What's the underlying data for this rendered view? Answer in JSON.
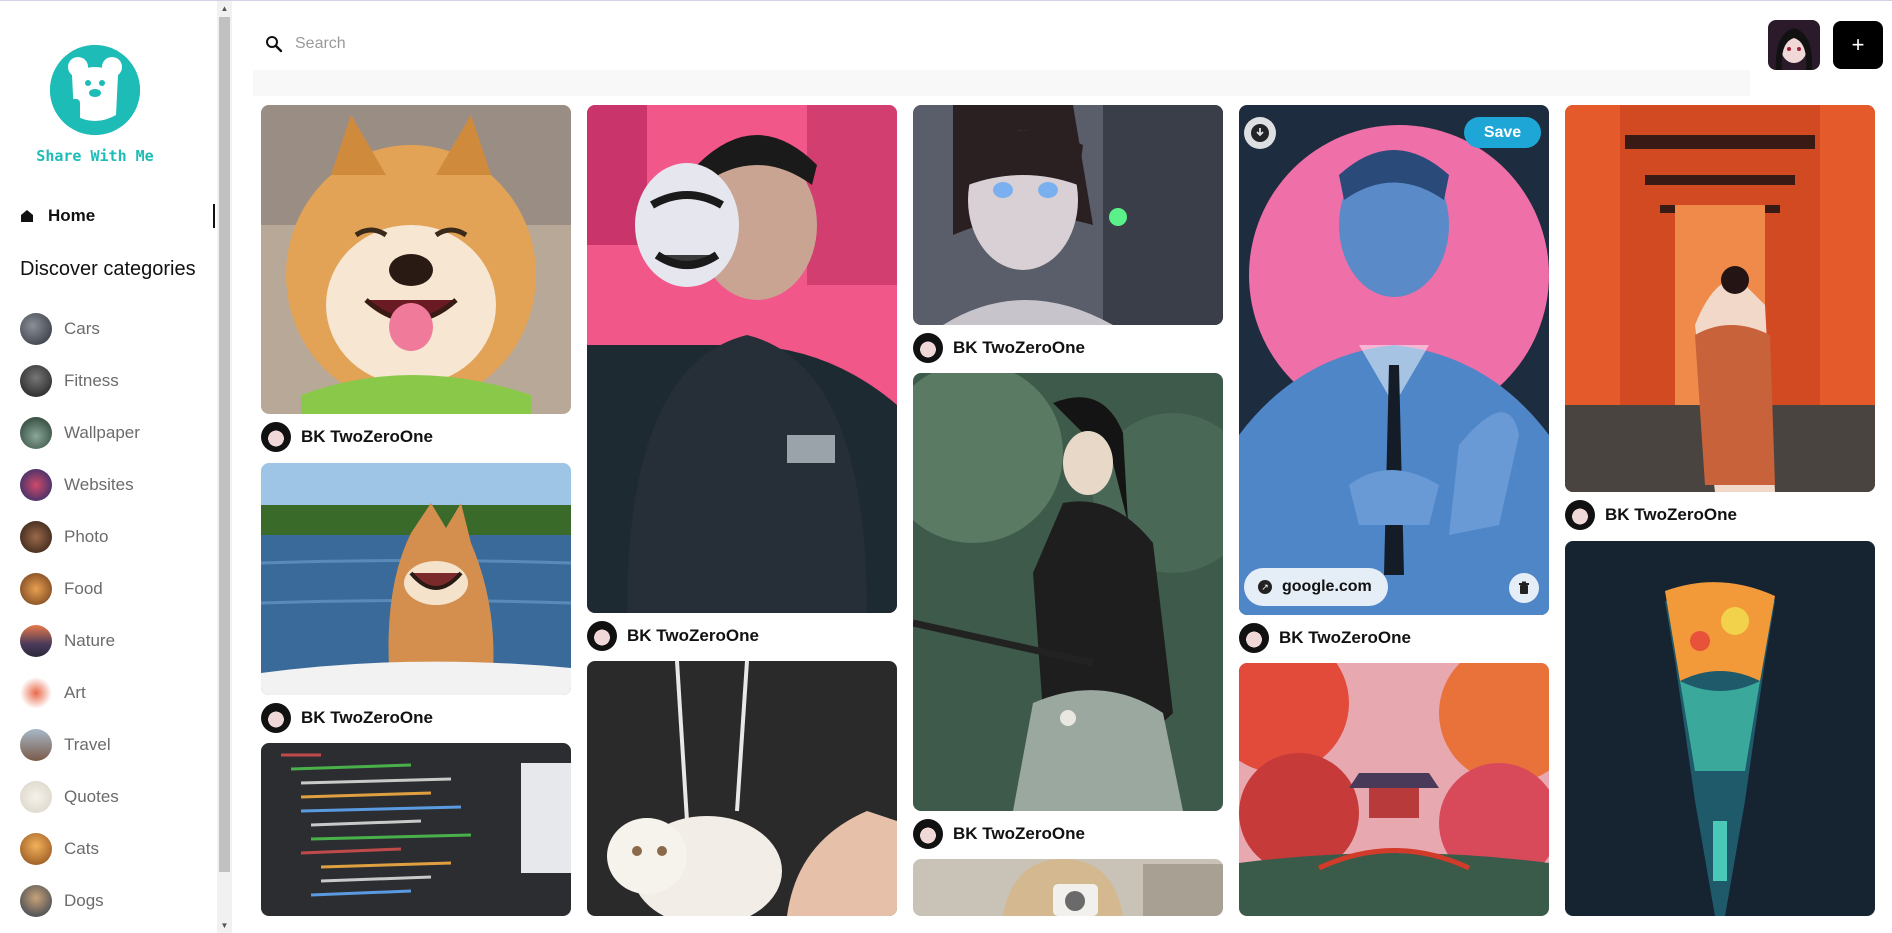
{
  "brand": {
    "name": "Share With Me"
  },
  "nav": {
    "home_label": "Home"
  },
  "categories_title": "Discover categories",
  "categories": [
    {
      "label": "Cars",
      "color": "#4a4f58"
    },
    {
      "label": "Fitness",
      "color": "#2b2b2b"
    },
    {
      "label": "Wallpaper",
      "color": "#3c5a4a"
    },
    {
      "label": "Websites",
      "color": "#2a3f7a"
    },
    {
      "label": "Photo",
      "color": "#5a3b2a"
    },
    {
      "label": "Food",
      "color": "#b46a2c"
    },
    {
      "label": "Nature",
      "color": "#a0563a"
    },
    {
      "label": "Art",
      "color": "#d2503a"
    },
    {
      "label": "Travel",
      "color": "#7a6a5a"
    },
    {
      "label": "Quotes",
      "color": "#e8e4dc"
    },
    {
      "label": "Cats",
      "color": "#c9852f"
    },
    {
      "label": "Dogs",
      "color": "#3d4a5a"
    }
  ],
  "search": {
    "placeholder": "Search"
  },
  "header": {
    "add_label": "+"
  },
  "pins": {
    "username": "BK TwoZeroOne",
    "save_label": "Save",
    "link_label": "google.com"
  },
  "colors": {
    "accent": "#1ebcb6",
    "save": "#1ea7d6"
  }
}
